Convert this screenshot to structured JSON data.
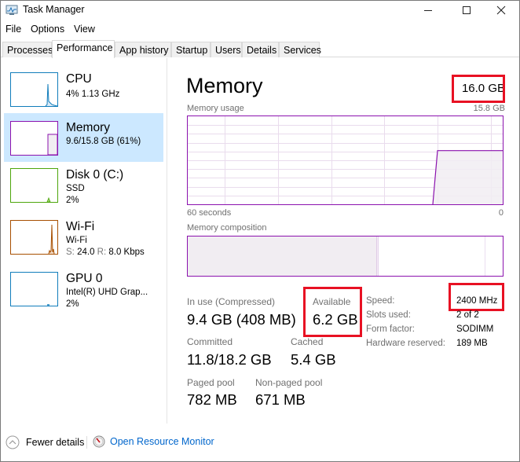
{
  "window": {
    "title": "Task Manager",
    "controls": [
      "minimize",
      "maximize",
      "close"
    ]
  },
  "menu": [
    "File",
    "Options",
    "View"
  ],
  "tabs": [
    {
      "label": "Processes",
      "active": false
    },
    {
      "label": "Performance",
      "active": true
    },
    {
      "label": "App history",
      "active": false
    },
    {
      "label": "Startup",
      "active": false
    },
    {
      "label": "Users",
      "active": false
    },
    {
      "label": "Details",
      "active": false
    },
    {
      "label": "Services",
      "active": false
    }
  ],
  "sidebar": {
    "items": [
      {
        "title": "CPU",
        "line1": "4% 1.13 GHz",
        "line2": "",
        "color": "#117dbb",
        "selected": false
      },
      {
        "title": "Memory",
        "line1": "9.6/15.8 GB (61%)",
        "line2": "",
        "color": "#8b12ae",
        "selected": true
      },
      {
        "title": "Disk 0 (C:)",
        "line1": "SSD",
        "line2": "2%",
        "color": "#4da60c",
        "selected": false
      },
      {
        "title": "Wi-Fi",
        "line1": "Wi-Fi",
        "line2_s_label": "S:",
        "line2_s": "24.0",
        "line2_r_label": "R:",
        "line2_r": "8.0 Kbps",
        "color": "#a74f01",
        "selected": false
      },
      {
        "title": "GPU 0",
        "line1": "Intel(R) UHD Grap...",
        "line2": "2%",
        "color": "#117dbb",
        "selected": false
      }
    ]
  },
  "main": {
    "title": "Memory",
    "total": "16.0 GB",
    "usage_label": "Memory usage",
    "usage_max": "15.8 GB",
    "axis_left": "60 seconds",
    "axis_right": "0",
    "usage_percent": 61,
    "composition_label": "Memory composition",
    "composition": {
      "in_use_fraction": 0.6,
      "modified_fraction": 0.005,
      "standby_fraction": 0.34,
      "free_fraction": 0.055
    },
    "stats": {
      "in_use_label": "In use (Compressed)",
      "in_use_value": "9.4 GB (408 MB)",
      "available_label": "Available",
      "available_value": "6.2 GB",
      "committed_label": "Committed",
      "committed_value": "11.8/18.2 GB",
      "cached_label": "Cached",
      "cached_value": "5.4 GB",
      "paged_label": "Paged pool",
      "paged_value": "782 MB",
      "nonpaged_label": "Non-paged pool",
      "nonpaged_value": "671 MB"
    },
    "details": [
      {
        "key": "Speed:",
        "value": "2400 MHz"
      },
      {
        "key": "Slots used:",
        "value": "2 of 2"
      },
      {
        "key": "Form factor:",
        "value": "SODIMM"
      },
      {
        "key": "Hardware reserved:",
        "value": "189 MB"
      }
    ]
  },
  "footer": {
    "fewer_details": "Fewer details",
    "resource_monitor": "Open Resource Monitor"
  },
  "colors": {
    "memory_accent": "#8b12ae",
    "highlight_box": "#e81123",
    "selected_bg": "#cce8ff",
    "link": "#0066cc"
  }
}
